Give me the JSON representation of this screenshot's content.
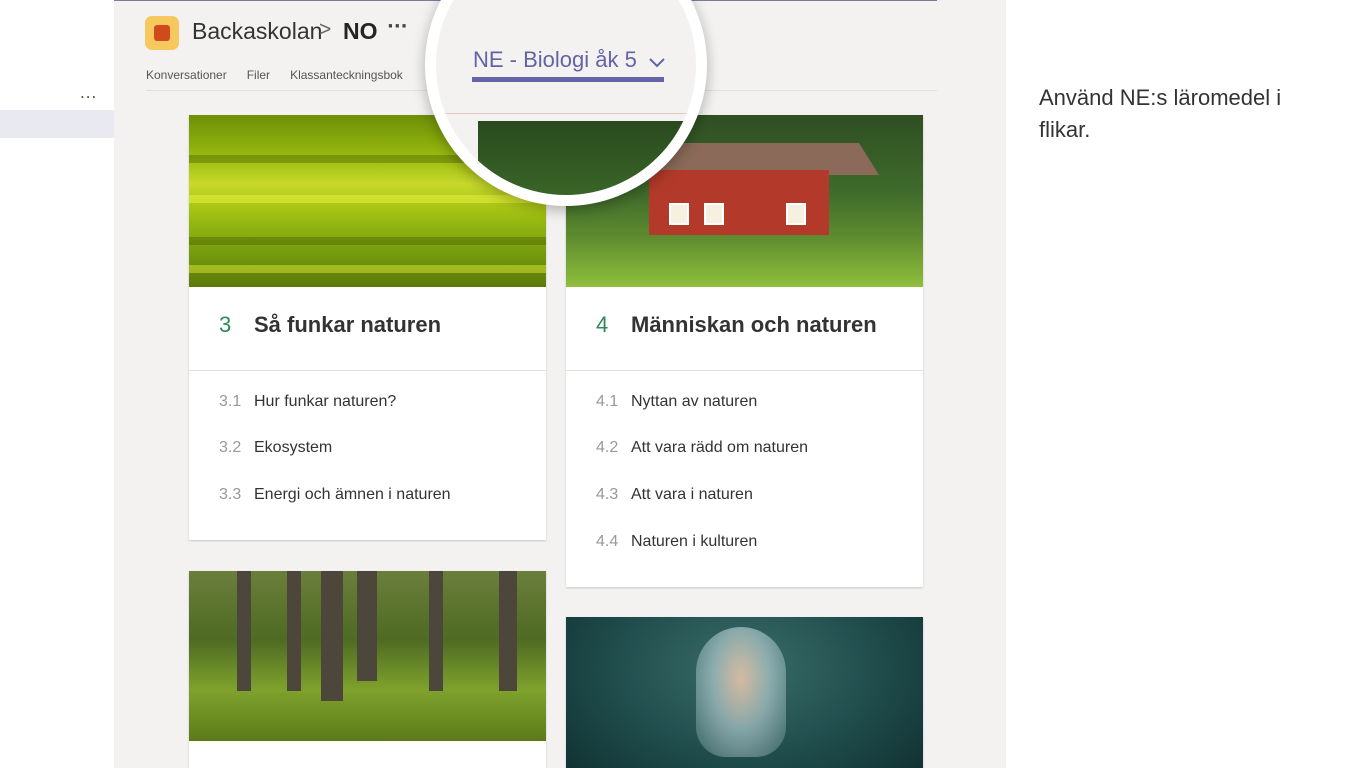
{
  "rail": {
    "more_label": "..."
  },
  "header": {
    "team_name": "Backaskolan",
    "separator": ">",
    "channel_name": "NO",
    "channel_more": "···",
    "tabs": [
      "Konversationer",
      "Filer",
      "Klassanteckningsbok"
    ]
  },
  "magnifier": {
    "active_tab_label": "NE - Biologi åk 5",
    "dropdown_icon": "chevron-down-icon"
  },
  "chapters": [
    {
      "number": "3",
      "title": "Så funkar naturen",
      "image": "algae-macro",
      "sections": [
        {
          "number": "3.1",
          "title": "Hur funkar naturen?"
        },
        {
          "number": "3.2",
          "title": "Ekosystem"
        },
        {
          "number": "3.3",
          "title": "Energi och ämnen i naturen"
        }
      ]
    },
    {
      "number": "4",
      "title": "Människan och naturen",
      "image": "red-cottage",
      "sections": [
        {
          "number": "4.1",
          "title": "Nyttan av naturen"
        },
        {
          "number": "4.2",
          "title": "Att vara rädd om naturen"
        },
        {
          "number": "4.3",
          "title": "Att vara i naturen"
        },
        {
          "number": "4.4",
          "title": "Naturen i kulturen"
        }
      ]
    },
    {
      "image": "mossy-forest"
    },
    {
      "image": "jellyfish"
    }
  ],
  "caption": "Använd NE:s läromedel i flikar.",
  "colors": {
    "accent": "#6264a7",
    "chapter_number": "#2e8b57",
    "house_red": "#b33a2a"
  }
}
